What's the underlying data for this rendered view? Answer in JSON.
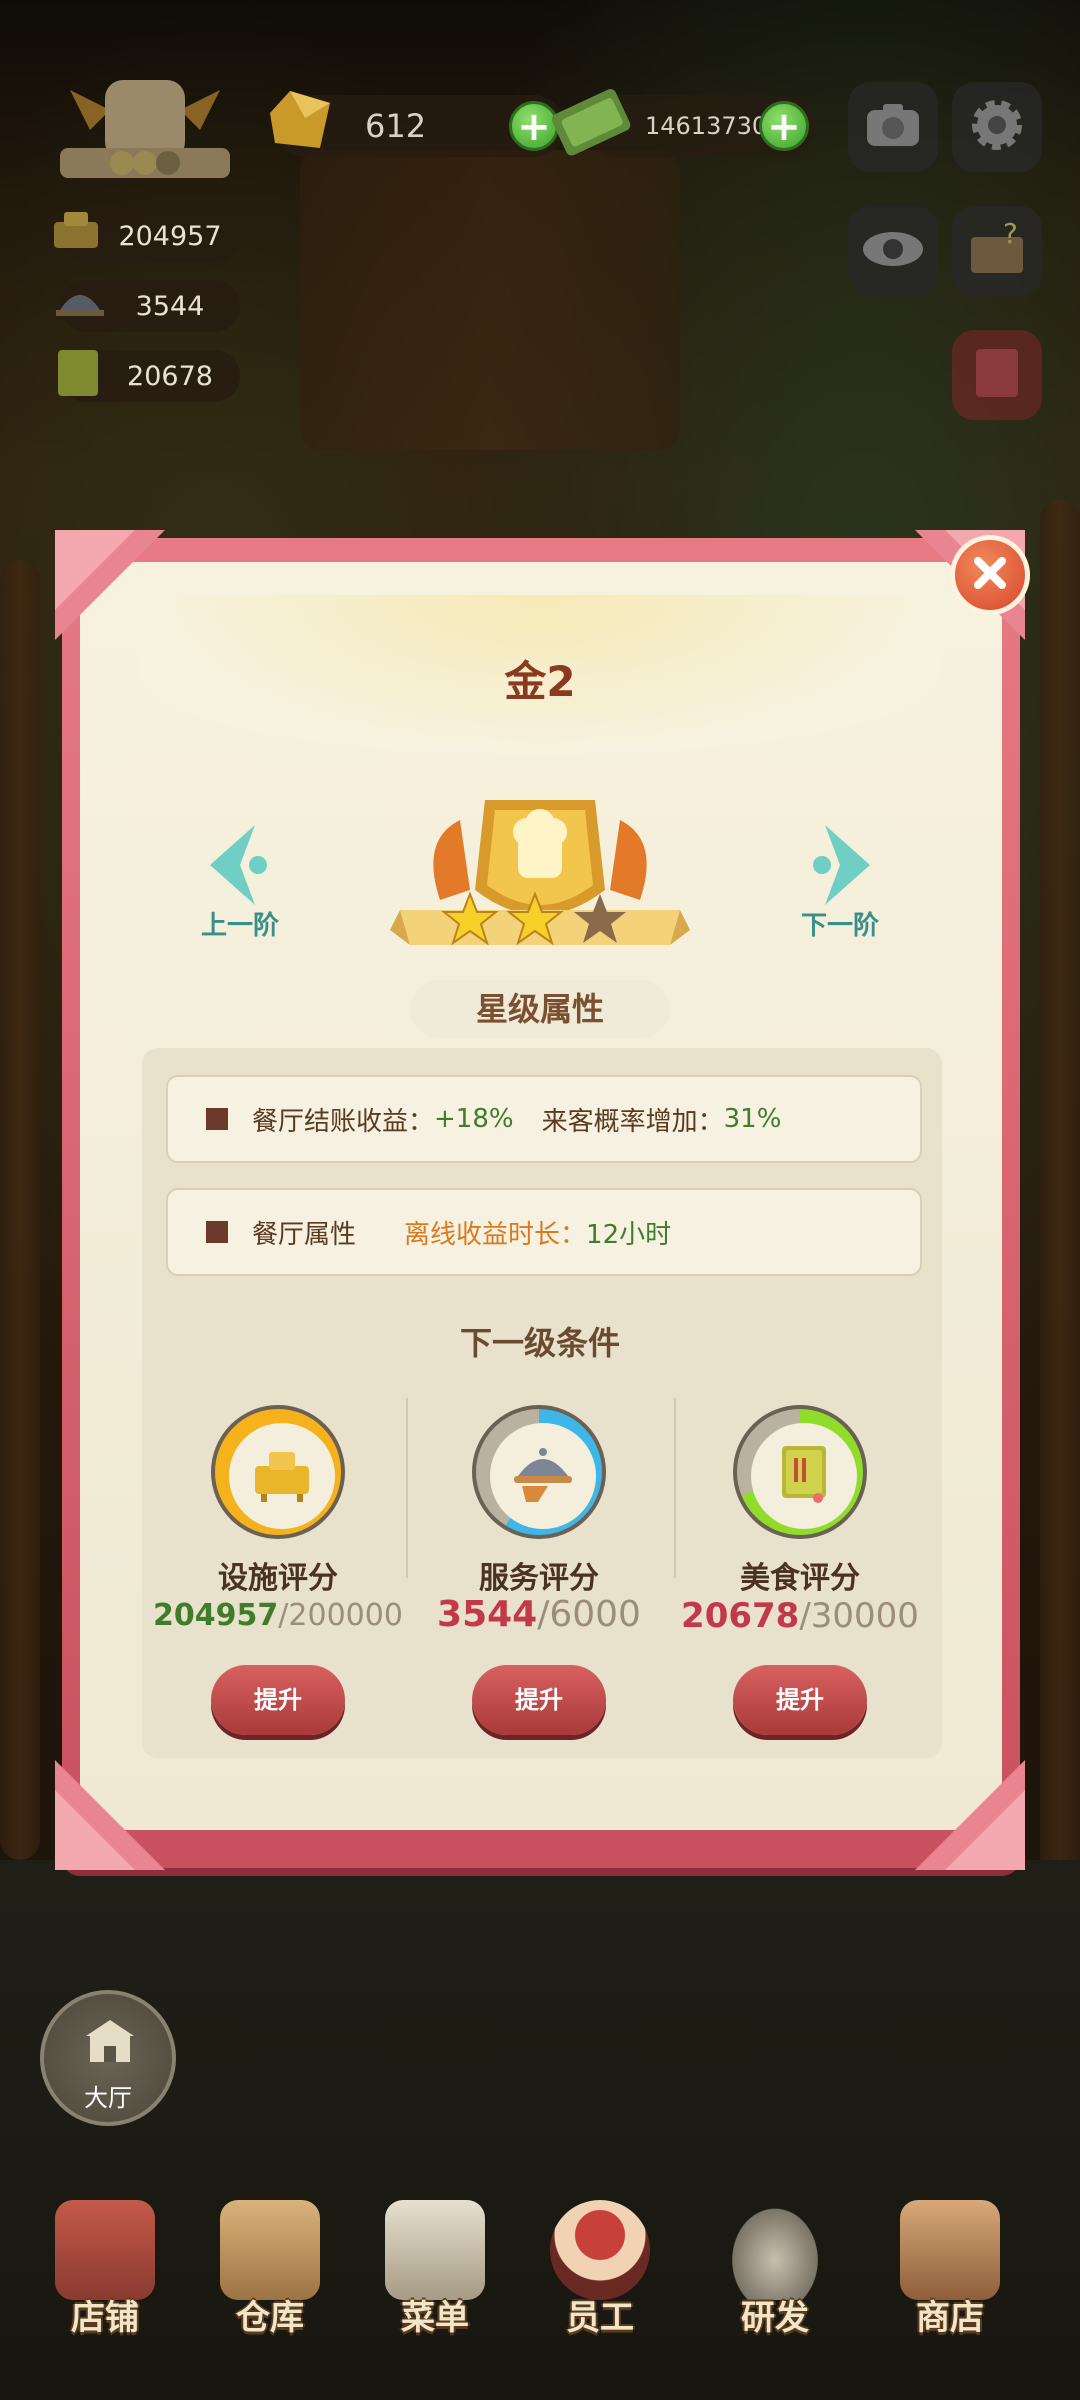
{
  "hud": {
    "gems": "612",
    "cash": "14613730",
    "facility_score": "204957",
    "service_score": "3544",
    "food_score": "20678"
  },
  "dialog": {
    "title": "金2",
    "prev_label": "上一阶",
    "next_label": "下一阶",
    "section_title": "星级属性",
    "attr_row1_a_label": "餐厅结账收益：",
    "attr_row1_a_value": "+18%",
    "attr_row1_b_label": "来客概率增加：",
    "attr_row1_b_value": "31%",
    "attr_row2_label": "餐厅属性",
    "attr_row2_key": "离线收益时长：",
    "attr_row2_value": "12小时",
    "next_level_title": "下一级条件",
    "stars_filled": 2,
    "stars_total": 3,
    "conditions": [
      {
        "label": "设施评分",
        "current": "204957",
        "target": "/200000",
        "progress": 1.0,
        "color": "#f5b21d",
        "upgrade": "提升"
      },
      {
        "label": "服务评分",
        "current": "3544",
        "target": "/6000",
        "progress": 0.59,
        "color": "#3fb6e8",
        "upgrade": "提升"
      },
      {
        "label": "美食评分",
        "current": "20678",
        "target": "/30000",
        "progress": 0.69,
        "color": "#8fdc2a",
        "upgrade": "提升"
      }
    ]
  },
  "hall_label": "大厅",
  "bottom_nav": [
    "店铺",
    "仓库",
    "菜单",
    "员工",
    "研发",
    "商店"
  ]
}
